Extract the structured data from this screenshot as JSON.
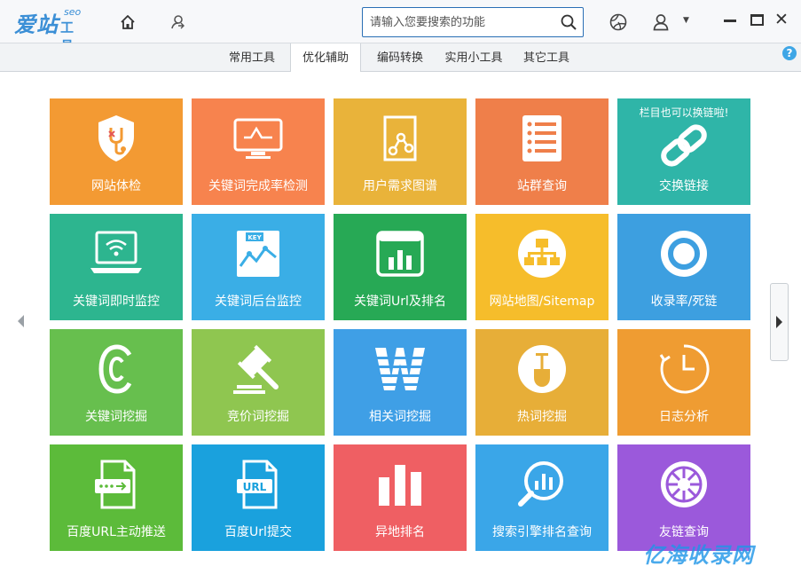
{
  "app": {
    "logo_main": "爱站",
    "logo_sup": "seo",
    "logo_sub": "工具包"
  },
  "search": {
    "placeholder": "请输入您要搜索的功能"
  },
  "tabs": [
    {
      "label": "常用工具",
      "active": false
    },
    {
      "label": "优化辅助",
      "active": true
    },
    {
      "label": "编码转换",
      "active": false
    },
    {
      "label": "实用小工具",
      "active": false
    },
    {
      "label": "其它工具",
      "active": false
    }
  ],
  "help_label": "?",
  "tiles": [
    {
      "label": "网站体检",
      "color": "#f39a33",
      "icon": "shield-stethoscope-icon"
    },
    {
      "label": "关键词完成率检测",
      "color": "#f7834e",
      "icon": "monitor-pulse-icon"
    },
    {
      "label": "用户需求图谱",
      "color": "#e9b33a",
      "icon": "graph-doc-icon"
    },
    {
      "label": "站群查询",
      "color": "#ef7f4a",
      "icon": "list-doc-icon"
    },
    {
      "label": "交换链接",
      "color": "#2fb5a8",
      "icon": "chain-link-icon",
      "top_label": "栏目也可以换链啦!"
    },
    {
      "label": "关键词即时监控",
      "color": "#2db58f",
      "icon": "laptop-wifi-icon"
    },
    {
      "label": "关键词后台监控",
      "color": "#3aaee6",
      "icon": "keyword-chart-icon"
    },
    {
      "label": "关键词Url及排名",
      "color": "#27a955",
      "icon": "bar-chart-window-icon"
    },
    {
      "label": "网站地图/Sitemap",
      "color": "#f6bd2b",
      "icon": "sitemap-icon"
    },
    {
      "label": "收录率/死链",
      "color": "#3d9fe0",
      "icon": "ring-icon"
    },
    {
      "label": "关键词挖掘",
      "color": "#67bf4e",
      "icon": "letter-c-icon"
    },
    {
      "label": "竞价词挖掘",
      "color": "#8fc650",
      "icon": "gavel-icon"
    },
    {
      "label": "相关词挖掘",
      "color": "#3f9fe6",
      "icon": "letter-w-icon"
    },
    {
      "label": "热词挖掘",
      "color": "#e7ae38",
      "icon": "shovel-icon"
    },
    {
      "label": "日志分析",
      "color": "#ef9c32",
      "icon": "clock-icon"
    },
    {
      "label": "百度URL主动推送",
      "color": "#5cbb3a",
      "icon": "file-push-icon"
    },
    {
      "label": "百度Url提交",
      "color": "#1aa1dd",
      "icon": "file-url-icon"
    },
    {
      "label": "异地排名",
      "color": "#ef5f63",
      "icon": "bars-icon"
    },
    {
      "label": "搜索引擎排名查询",
      "color": "#3aa6e8",
      "icon": "search-chart-icon"
    },
    {
      "label": "友链查询",
      "color": "#9b59db",
      "icon": "wheel-icon"
    }
  ],
  "url_icon_text": "URL",
  "kev_icon_text": "KEY",
  "watermark": "亿海收录网"
}
